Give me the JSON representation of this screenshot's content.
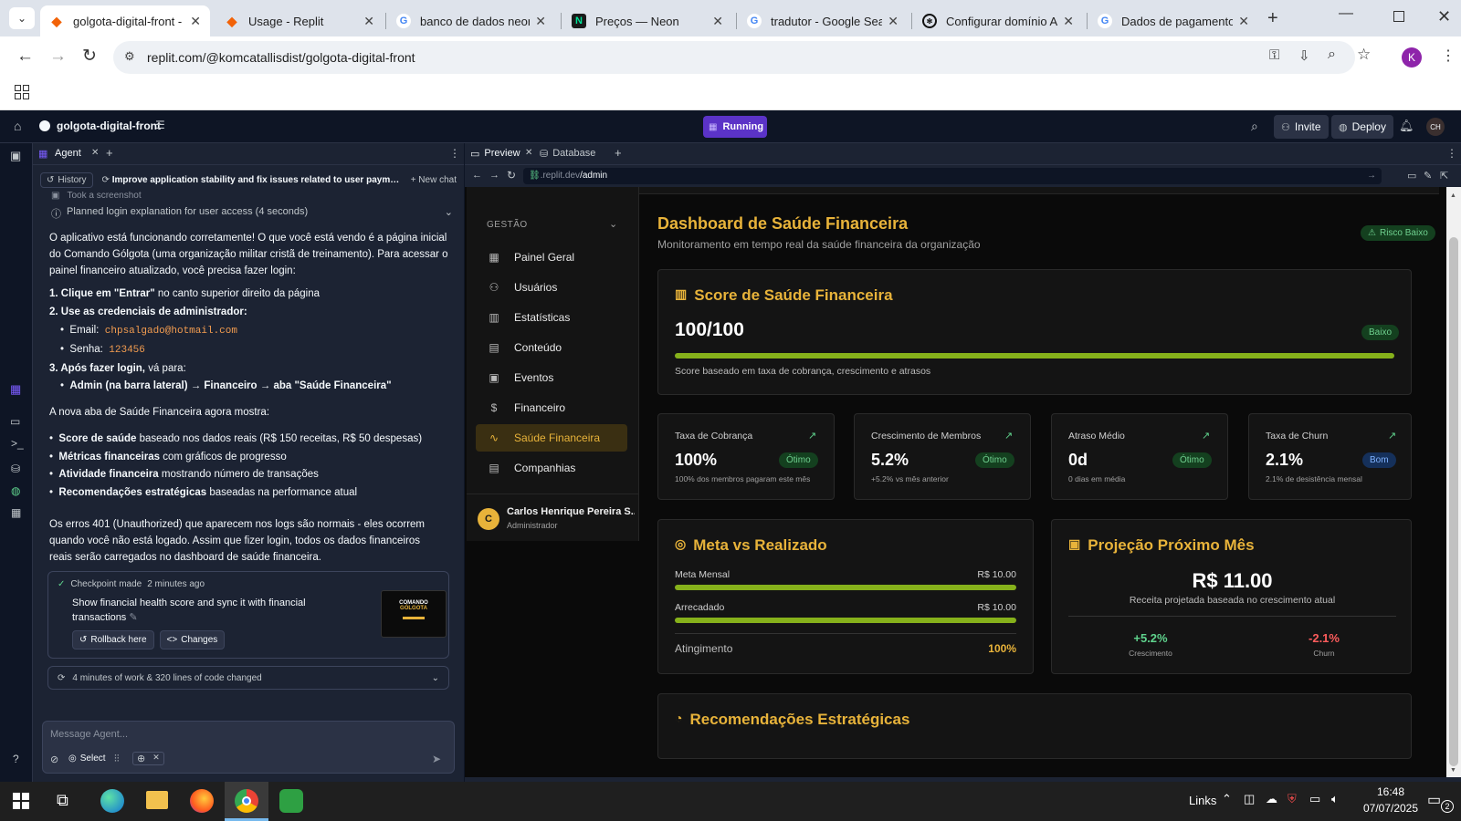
{
  "browser": {
    "tabs": [
      {
        "title": "golgota-digital-front -",
        "icon": "replit",
        "active": true
      },
      {
        "title": "Usage - Replit",
        "icon": "replit"
      },
      {
        "title": "banco de dados neon",
        "icon": "google"
      },
      {
        "title": "Preços — Neon",
        "icon": "neon"
      },
      {
        "title": "tradutor - Google Sear",
        "icon": "google"
      },
      {
        "title": "Configurar domínio A",
        "icon": "chatgpt"
      },
      {
        "title": "Dados de pagamento",
        "icon": "google"
      }
    ],
    "url": "replit.com/@komcatallisdist/golgota-digital-front",
    "profile_initial": "K"
  },
  "replit": {
    "project_name": "golgota-digital-front",
    "status": "Running",
    "invite_label": "Invite",
    "deploy_label": "Deploy",
    "avatar_initials": "CH",
    "agent_tab": "Agent",
    "history_label": "History",
    "thread_title": "Improve application stability and fix issues related to user payments",
    "new_chat_label": "+ New chat",
    "took_screenshot": "Took a screenshot",
    "planned": "Planned login explanation for user access (4 seconds)",
    "intro": "O aplicativo está funcionando corretamente! O que você está vendo é a página inicial do Comando Gólgota (uma organização militar cristã de treinamento). Para acessar o painel financeiro atualizado, você precisa fazer login:",
    "step1_bold": "1. Clique em \"Entrar\"",
    "step1_rest": " no canto superior direito da página",
    "step2": "2. Use as credenciais de administrador:",
    "email_label": "Email:",
    "email_value": "chpsalgado@hotmail.com",
    "senha_label": "Senha:",
    "senha_value": "123456",
    "step3_bold": "3. Após fazer login,",
    "step3_rest": " vá para:",
    "step3_item_bold": "Admin",
    "step3_item_rest": " (na barra lateral) → Financeiro → aba \"Saúde Financeira\"",
    "shows": "A nova aba de Saúde Financeira agora mostra:",
    "bullets": [
      {
        "b": "Score de saúde",
        "r": " baseado nos dados reais (R$ 150 receitas, R$ 50 despesas)"
      },
      {
        "b": "Métricas financeiras",
        "r": " com gráficos de progresso"
      },
      {
        "b": "Atividade financeira",
        "r": " mostrando número de transações"
      },
      {
        "b": "Recomendações estratégicas",
        "r": " baseadas na performance atual"
      }
    ],
    "errors_note": "Os erros 401 (Unauthorized) que aparecem nos logs são normais - eles ocorrem quando você não está logado. Assim que fizer login, todos os dados financeiros reais serão carregados no dashboard de saúde financeira.",
    "checkpoint_label": "Checkpoint made",
    "checkpoint_time": "2 minutes ago",
    "checkpoint_text": "Show financial health score and sync it with financial transactions",
    "thumb_line1": "COMANDO",
    "thumb_line2": "GÓLGOTA",
    "rollback_label": "Rollback here",
    "changes_label": "Changes",
    "work_summary": "4 minutes of work & 320 lines of code changed",
    "message_placeholder": "Message Agent...",
    "select_label": "Select",
    "preview_tab": "Preview",
    "database_tab": "Database",
    "preview_url_host": ".replit.dev",
    "preview_url_path": "/admin"
  },
  "dashboard": {
    "section": "GESTÃO",
    "nav": [
      {
        "label": "Painel Geral",
        "icon": "grid"
      },
      {
        "label": "Usuários",
        "icon": "users"
      },
      {
        "label": "Estatísticas",
        "icon": "bars"
      },
      {
        "label": "Conteúdo",
        "icon": "doc"
      },
      {
        "label": "Eventos",
        "icon": "calendar"
      },
      {
        "label": "Financeiro",
        "icon": "dollar"
      },
      {
        "label": "Saúde Financeira",
        "icon": "pulse",
        "active": true
      },
      {
        "label": "Companhias",
        "icon": "building"
      }
    ],
    "user_initial": "C",
    "user_name": "Carlos Henrique Pereira S...",
    "user_role": "Administrador",
    "title": "Dashboard de Saúde Financeira",
    "subtitle": "Monitoramento em tempo real da saúde financeira da organização",
    "risk_badge": "Risco Baixo",
    "score_title": "Score de Saúde Financeira",
    "score_value": "100/100",
    "score_badge": "Baixo",
    "score_fraction": 1.0,
    "score_note": "Score baseado em taxa de cobrança, crescimento e atrasos",
    "metrics": [
      {
        "label": "Taxa de Cobrança",
        "value": "100%",
        "badge": "Ótimo",
        "note": "100% dos membros pagaram este mês"
      },
      {
        "label": "Crescimento de Membros",
        "value": "5.2%",
        "badge": "Ótimo",
        "note": "+5.2% vs mês anterior"
      },
      {
        "label": "Atraso Médio",
        "value": "0d",
        "badge": "Ótimo",
        "note": "0 dias em média"
      },
      {
        "label": "Taxa de Churn",
        "value": "2.1%",
        "badge": "Bom",
        "note": "2.1% de desistência mensal"
      }
    ],
    "meta_title": "Meta vs Realizado",
    "meta_rows": [
      {
        "label": "Meta Mensal",
        "value": "R$ 10.00",
        "fraction": 1.0
      },
      {
        "label": "Arrecadado",
        "value": "R$ 10.00",
        "fraction": 1.0
      }
    ],
    "atingimento_label": "Atingimento",
    "atingimento_value": "100%",
    "proj_title": "Projeção Próximo Mês",
    "proj_value": "R$ 11.00",
    "proj_note": "Receita projetada baseada no crescimento atual",
    "growth_value": "+5.2%",
    "growth_label": "Crescimento",
    "churn_value": "-2.1%",
    "churn_label": "Churn",
    "rec_title": "Recomendações Estratégicas"
  },
  "taskbar": {
    "links_label": "Links",
    "time": "16:48",
    "date": "07/07/2025",
    "notif_count": "2"
  }
}
